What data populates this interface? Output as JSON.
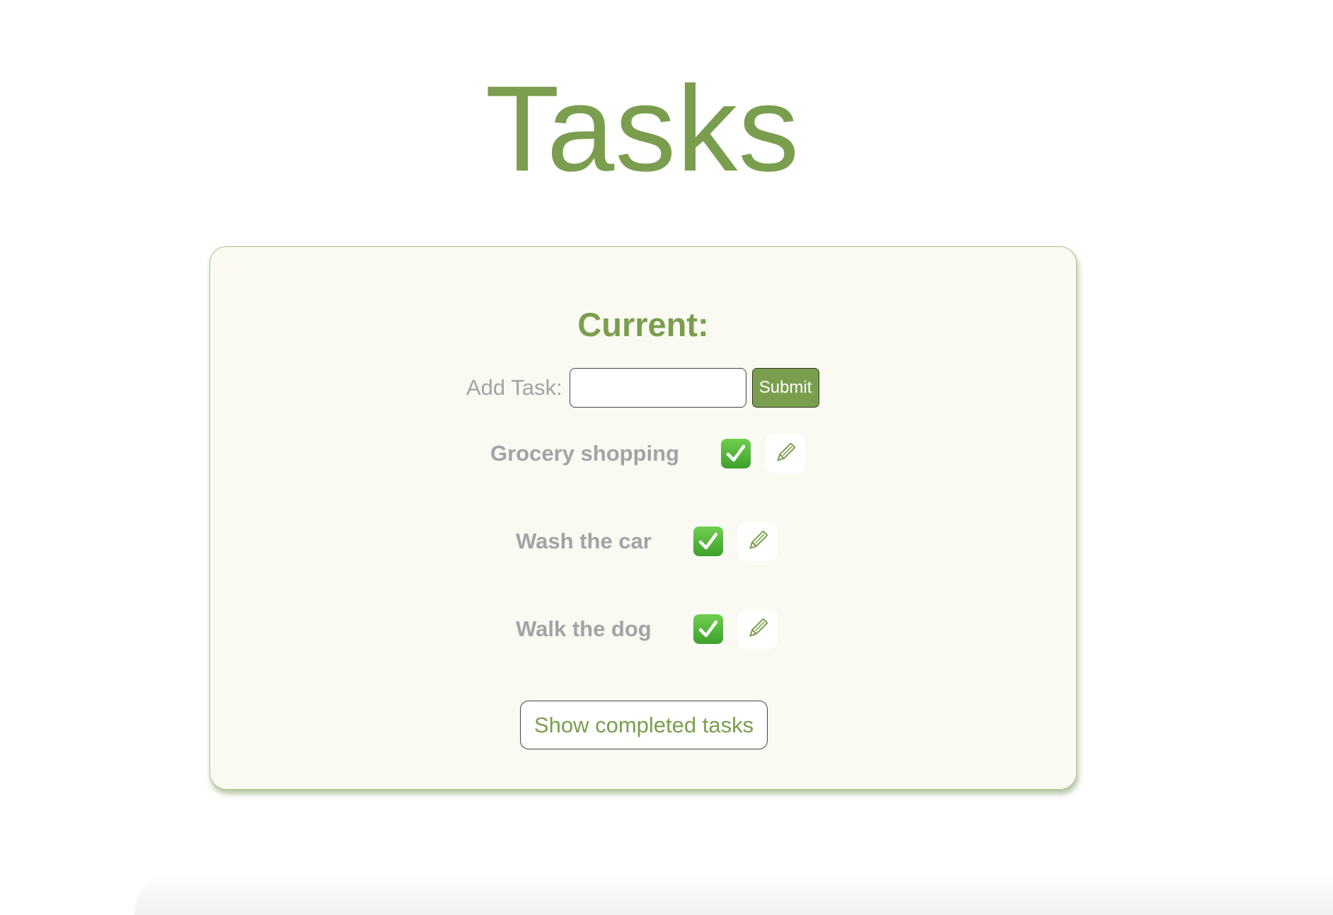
{
  "app": {
    "title": "Tasks"
  },
  "current": {
    "heading": "Current:",
    "add_label": "Add Task:",
    "input_value": "",
    "input_placeholder": "",
    "submit_label": "Submit"
  },
  "tasks": [
    {
      "label": "Grocery shopping",
      "complete_icon": "check-mark-button-icon",
      "edit_icon": "pencil-icon"
    },
    {
      "label": "Wash the car",
      "complete_icon": "check-mark-button-icon",
      "edit_icon": "pencil-icon"
    },
    {
      "label": "Walk the dog",
      "complete_icon": "check-mark-button-icon",
      "edit_icon": "pencil-icon"
    }
  ],
  "show_completed_label": "Show completed tasks",
  "colors": {
    "accent": "#7a9e4e",
    "card_background": "#fafaf2",
    "muted_text": "#a3a3a3",
    "check_green": "#4cb535"
  }
}
